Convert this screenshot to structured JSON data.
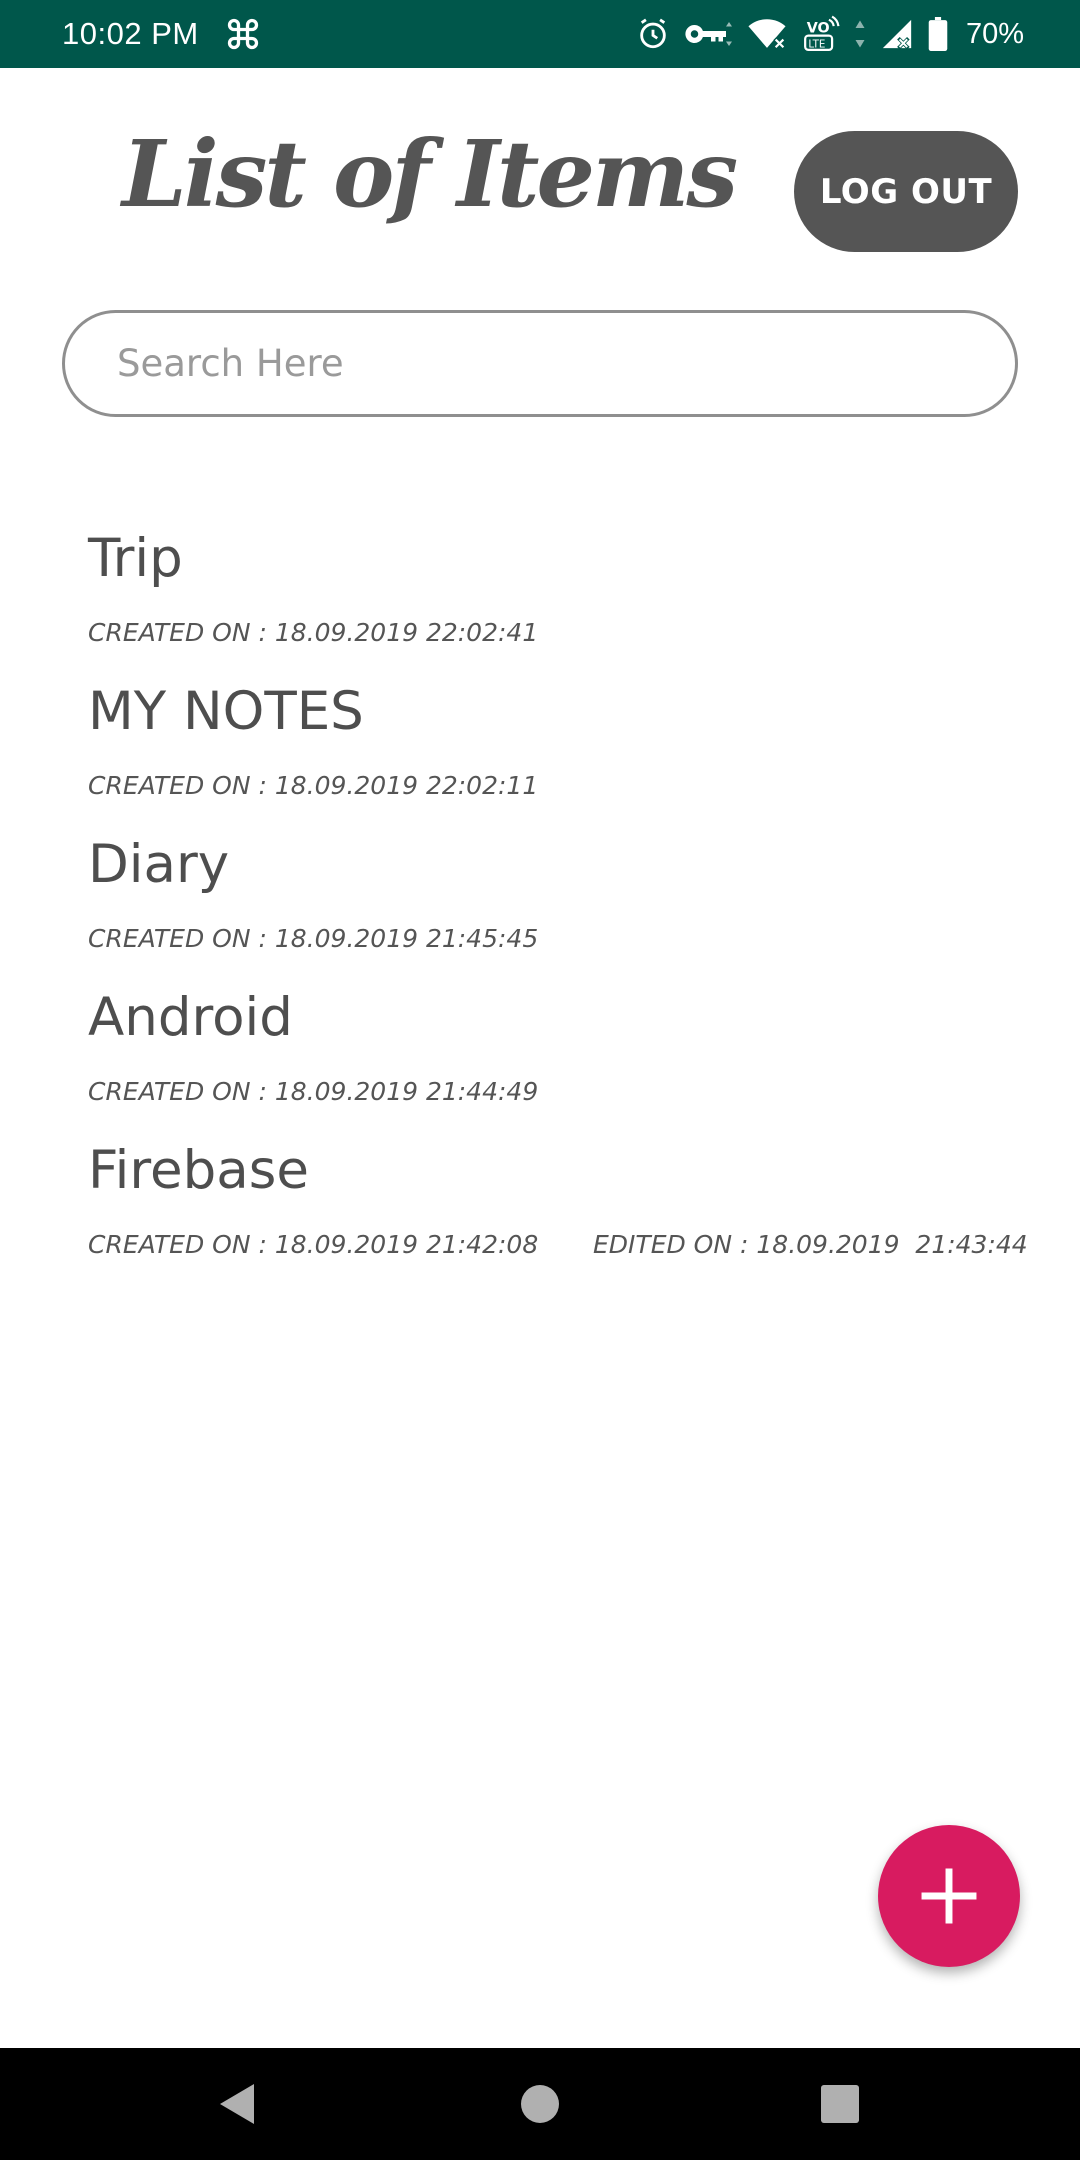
{
  "status_bar": {
    "time": "10:02 PM",
    "battery": "70%",
    "icons": [
      "command-icon",
      "alarm-icon",
      "vpn-key-icon",
      "wifi-icon",
      "volte-icon",
      "signal-icon",
      "battery-icon"
    ]
  },
  "header": {
    "title": "List of Items",
    "logout_label": "LOG OUT"
  },
  "search": {
    "placeholder": "Search Here",
    "value": ""
  },
  "items": [
    {
      "title": "Trip",
      "created": "CREATED ON : 18.09.2019 22:02:41",
      "edited": ""
    },
    {
      "title": "MY NOTES",
      "created": "CREATED ON : 18.09.2019 22:02:11",
      "edited": ""
    },
    {
      "title": "Diary",
      "created": "CREATED ON : 18.09.2019 21:45:45",
      "edited": ""
    },
    {
      "title": "Android",
      "created": "CREATED ON : 18.09.2019 21:44:49",
      "edited": ""
    },
    {
      "title": "Firebase",
      "created": "CREATED ON : 18.09.2019 21:42:08",
      "edited": "EDITED ON : 18.09.2019  21:43:44"
    }
  ],
  "fab": {
    "icon": "plus-icon"
  },
  "nav": {
    "icons": [
      "back-icon",
      "home-icon",
      "recents-icon"
    ]
  },
  "colors": {
    "status_bar": "#00574B",
    "accent": "#D81B60",
    "button": "#555555",
    "text": "#4E4E4E"
  }
}
